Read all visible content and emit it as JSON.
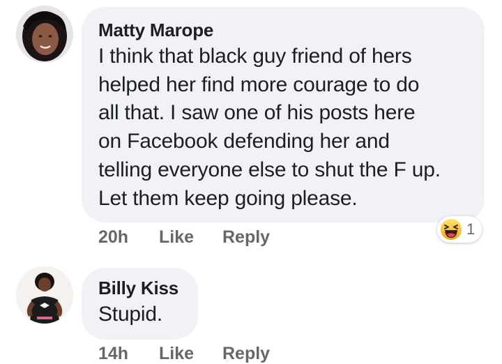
{
  "comments": [
    {
      "author": "Matty Marope",
      "lines": [
        "I think that black guy friend of hers",
        "helped her find more courage to do",
        "all that. I saw one of his posts here",
        "on Facebook defending her and",
        "telling everyone else to shut the F up.",
        "Let them keep going please."
      ],
      "time": "20h",
      "like_label": "Like",
      "reply_label": "Reply",
      "reaction": {
        "icon": "laughing-face-icon",
        "count": "1"
      }
    },
    {
      "author": "Billy Kiss",
      "lines": [
        "Stupid."
      ],
      "time": "14h",
      "like_label": "Like",
      "reply_label": "Reply"
    }
  ],
  "colors": {
    "bubble": "#f0f2f5",
    "text": "#1c1e21",
    "meta": "#65676b",
    "reaction_yellow": "#f7b125"
  }
}
